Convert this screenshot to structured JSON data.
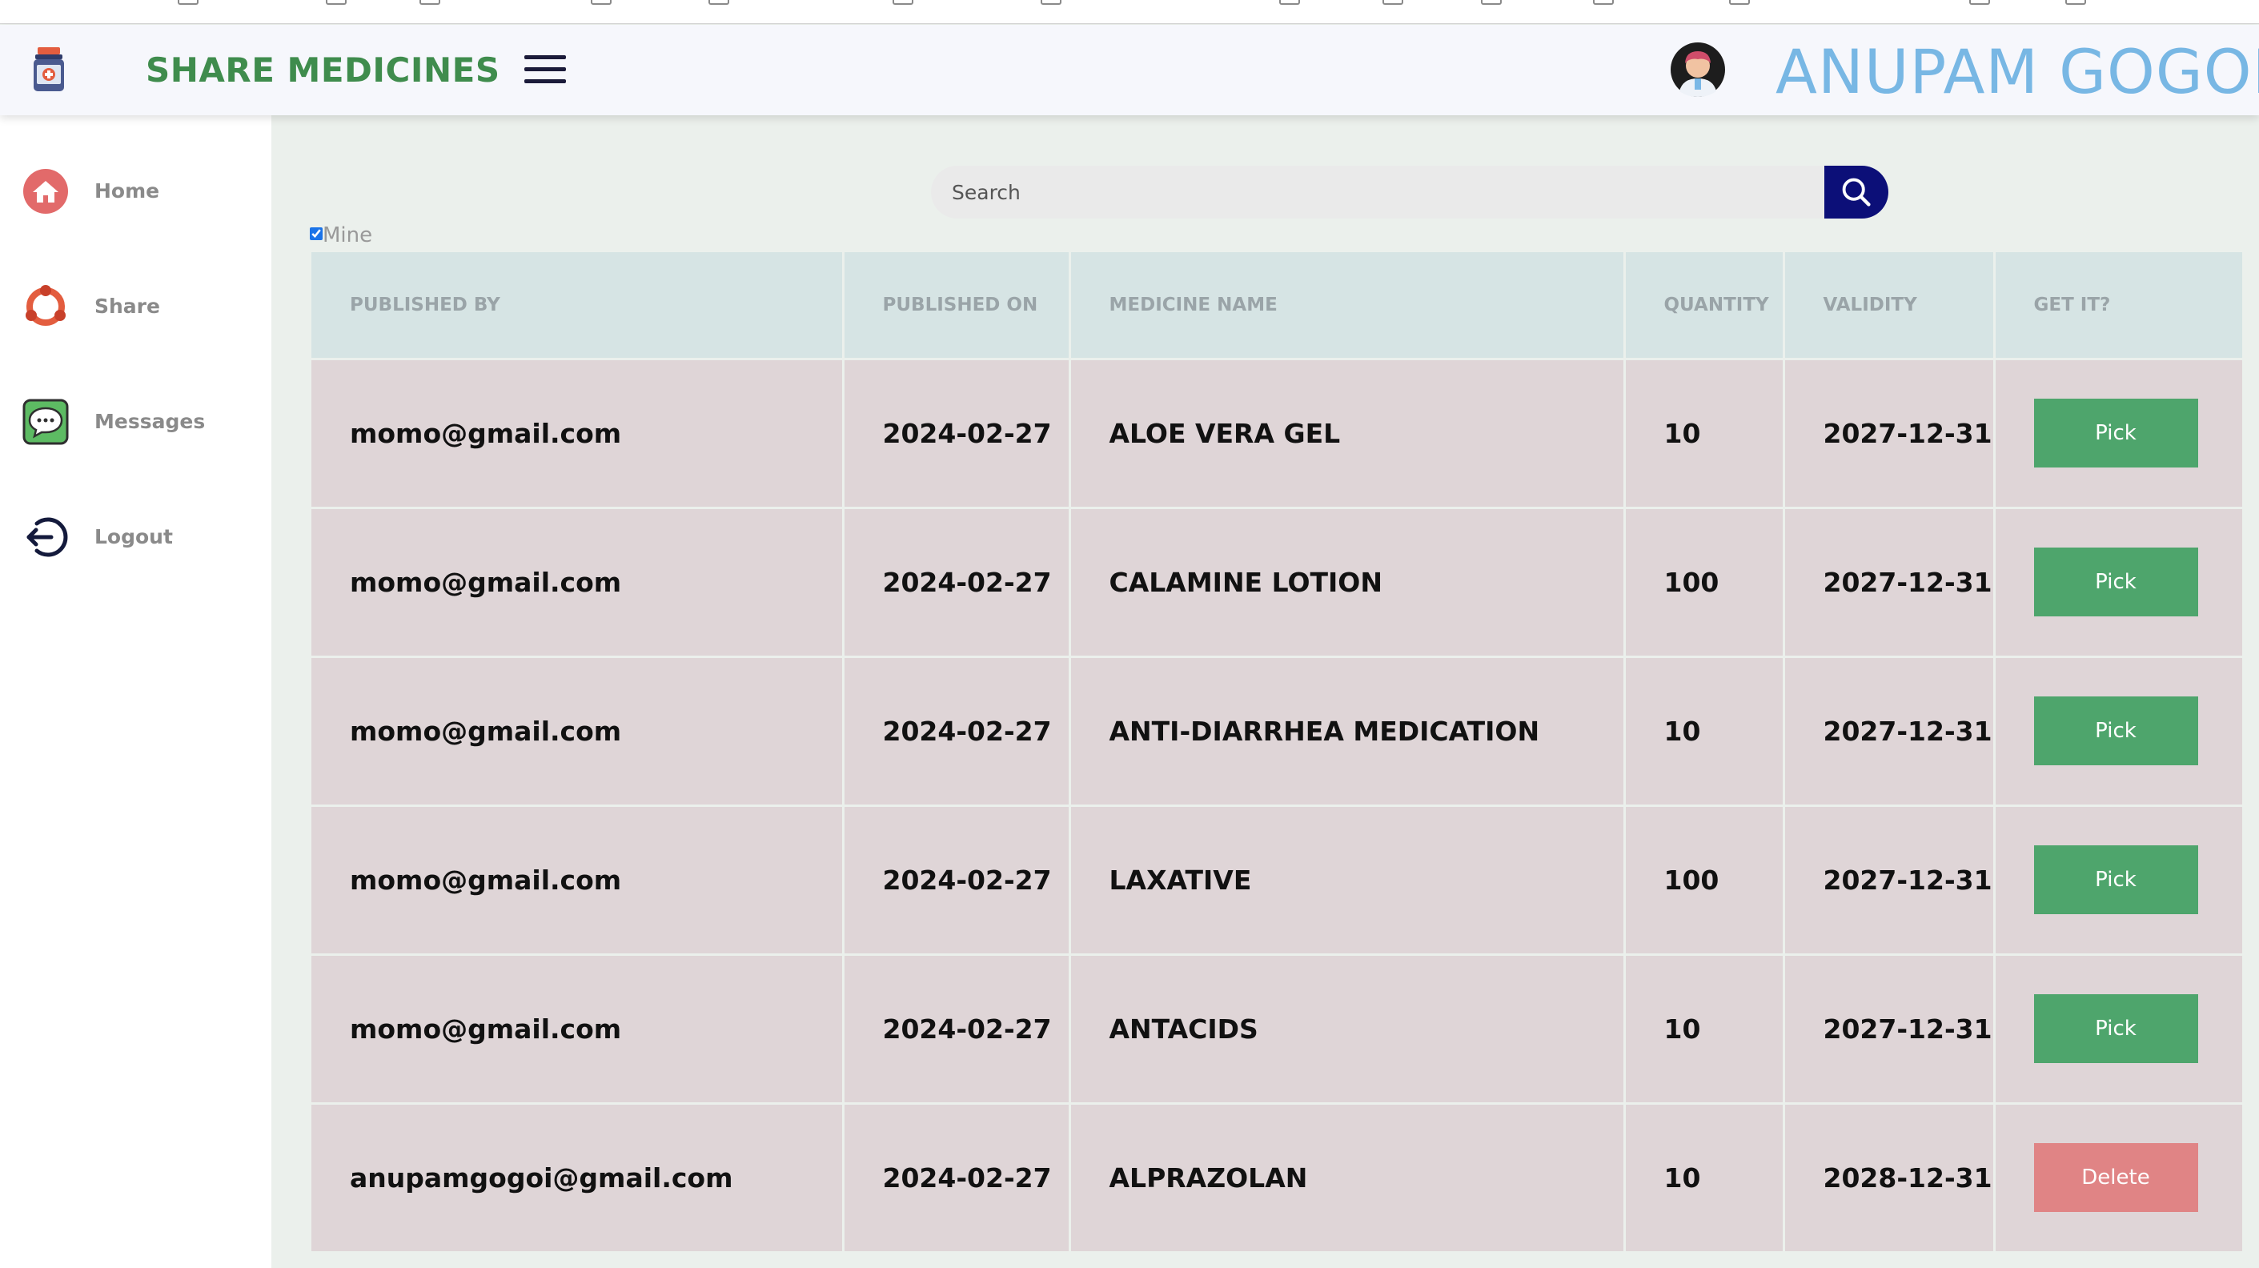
{
  "header": {
    "app_title": "SHARE MEDICINES",
    "user_name": "ANUPAM GOGOI"
  },
  "sidebar": {
    "items": [
      {
        "label": "Home",
        "icon": "home-icon"
      },
      {
        "label": "Share",
        "icon": "share-icon"
      },
      {
        "label": "Messages",
        "icon": "chat-icon"
      },
      {
        "label": "Logout",
        "icon": "logout-icon"
      }
    ]
  },
  "search": {
    "placeholder": "Search",
    "value": ""
  },
  "filter": {
    "mine_label": "Mine",
    "mine_checked": true
  },
  "table": {
    "columns": [
      "PUBLISHED BY",
      "PUBLISHED ON",
      "MEDICINE NAME",
      "QUANTITY",
      "VALIDITY",
      "GET IT?"
    ],
    "rows": [
      {
        "published_by": "momo@gmail.com",
        "published_on": "2024-02-27",
        "medicine": "ALOE VERA GEL",
        "quantity": "10",
        "validity": "2027-12-31",
        "action": "Pick"
      },
      {
        "published_by": "momo@gmail.com",
        "published_on": "2024-02-27",
        "medicine": "CALAMINE LOTION",
        "quantity": "100",
        "validity": "2027-12-31",
        "action": "Pick"
      },
      {
        "published_by": "momo@gmail.com",
        "published_on": "2024-02-27",
        "medicine": "ANTI-DIARRHEA MEDICATION",
        "quantity": "10",
        "validity": "2027-12-31",
        "action": "Pick"
      },
      {
        "published_by": "momo@gmail.com",
        "published_on": "2024-02-27",
        "medicine": "LAXATIVE",
        "quantity": "100",
        "validity": "2027-12-31",
        "action": "Pick"
      },
      {
        "published_by": "momo@gmail.com",
        "published_on": "2024-02-27",
        "medicine": "ANTACIDS",
        "quantity": "10",
        "validity": "2027-12-31",
        "action": "Pick"
      },
      {
        "published_by": "anupamgogoi@gmail.com",
        "published_on": "2024-02-27",
        "medicine": "ALPRAZOLAN",
        "quantity": "10",
        "validity": "2028-12-31",
        "action": "Delete"
      }
    ]
  },
  "colors": {
    "brand_green": "#3f8c4d",
    "user_name_blue": "#78b7e4",
    "search_button": "#0c0f78",
    "pick_button": "#4ea56c",
    "delete_button": "#e08485"
  }
}
